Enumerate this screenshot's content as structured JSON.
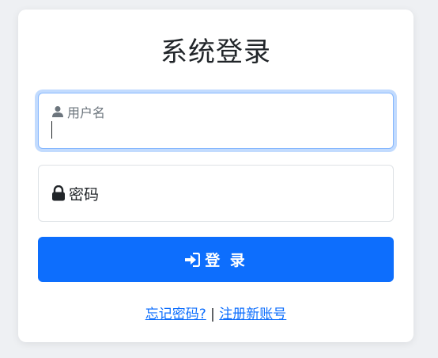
{
  "login": {
    "title": "系统登录",
    "username": {
      "label": "用户名",
      "value": ""
    },
    "password": {
      "label": "密码"
    },
    "submit_label": "登 录",
    "forgot_link": "忘记密码?",
    "separator": "|",
    "register_link": "注册新账号"
  },
  "colors": {
    "primary": "#0d6efd",
    "focus_border": "#86b7fe",
    "text": "#212529",
    "muted": "#6c757d",
    "background": "#eef0f3",
    "card": "#ffffff"
  },
  "icons": {
    "username": "person-icon",
    "password": "lock-icon",
    "submit": "sign-in-icon"
  }
}
